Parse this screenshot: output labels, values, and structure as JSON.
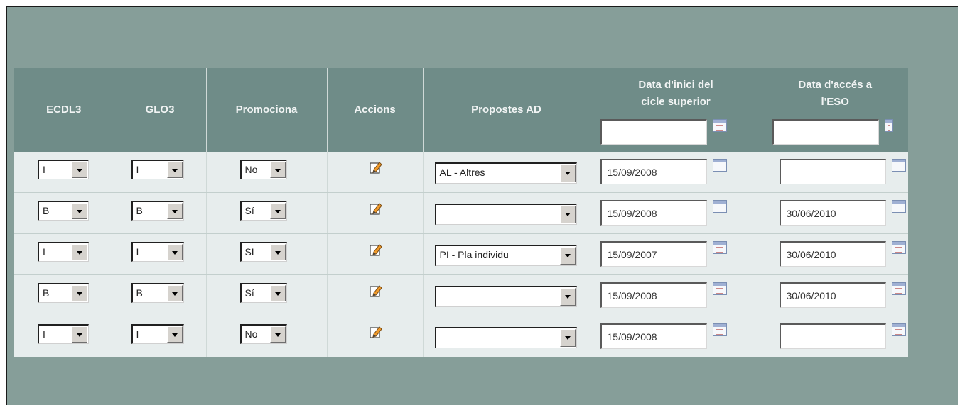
{
  "columns": {
    "ecdl3": "ECDL3",
    "glo3": "GLO3",
    "promociona": "Promociona",
    "accions": "Accions",
    "propostes": "Propostes AD",
    "data_inici_l1": "Data d'inici del",
    "data_inici_l2": "cicle superior",
    "data_acces_l1": "Data d'accés a",
    "data_acces_l2": "l'ESO"
  },
  "header_filters": {
    "data_inici": "",
    "data_acces": ""
  },
  "rows": [
    {
      "ecdl3": "I",
      "glo3": "I",
      "promociona": "No",
      "propostes": "AL - Altres",
      "data_inici": "15/09/2008",
      "data_acces": ""
    },
    {
      "ecdl3": "B",
      "glo3": "B",
      "promociona": "Sí",
      "propostes": "",
      "data_inici": "15/09/2008",
      "data_acces": "30/06/2010"
    },
    {
      "ecdl3": "I",
      "glo3": "I",
      "promociona": "SL",
      "propostes": "PI - Pla individu",
      "data_inici": "15/09/2007",
      "data_acces": "30/06/2010"
    },
    {
      "ecdl3": "B",
      "glo3": "B",
      "promociona": "Sí",
      "propostes": "",
      "data_inici": "15/09/2008",
      "data_acces": "30/06/2010"
    },
    {
      "ecdl3": "I",
      "glo3": "I",
      "promociona": "No",
      "propostes": "",
      "data_inici": "15/09/2008",
      "data_acces": ""
    }
  ],
  "icons": {
    "edit": "edit-pencil-icon",
    "calendar": "calendar-icon",
    "dropdown": "chevron-down-icon"
  },
  "colors": {
    "background": "#869e99",
    "header": "#6f8c88",
    "row": "#e7eded"
  }
}
